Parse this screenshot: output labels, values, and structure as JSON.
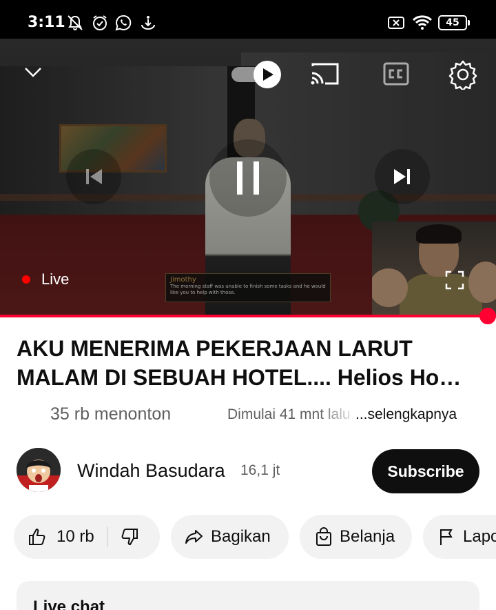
{
  "status_bar": {
    "time": "3:11",
    "battery": "45",
    "icons": [
      "notifications-muted-icon",
      "alarm-icon",
      "whatsapp-icon",
      "download-icon",
      "no-sim-icon",
      "wifi-icon",
      "battery-icon"
    ]
  },
  "player": {
    "live_label": "Live",
    "live_color": "#ff0000",
    "progress_color": "#ff0033",
    "progress": 0.983,
    "subtitle_speaker": "Jimothy",
    "subtitle_text": "The morning staff was unable to finish some tasks and he would like you to help with those.",
    "controls": [
      "chevron-down-icon",
      "autoplay-toggle",
      "cast-icon",
      "captions-icon",
      "settings-icon",
      "previous-icon",
      "pause-icon",
      "next-icon",
      "fullscreen-icon"
    ]
  },
  "video": {
    "title": "AKU MENERIMA PEKERJAAN LARUT MALAM DI SEBUAH HOTEL.... Helios Ho…",
    "views": "35 rb menonton",
    "started": "Dimulai 41 mnt lalu",
    "more": "...selengkapnya"
  },
  "channel": {
    "name": "Windah Basudara",
    "subscribers": "16,1 jt",
    "subscribe_label": "Subscribe"
  },
  "actions": {
    "likes": "10 rb",
    "share": "Bagikan",
    "shop": "Belanja",
    "report": "Laporkan"
  },
  "live_chat": {
    "label": "Live chat"
  }
}
